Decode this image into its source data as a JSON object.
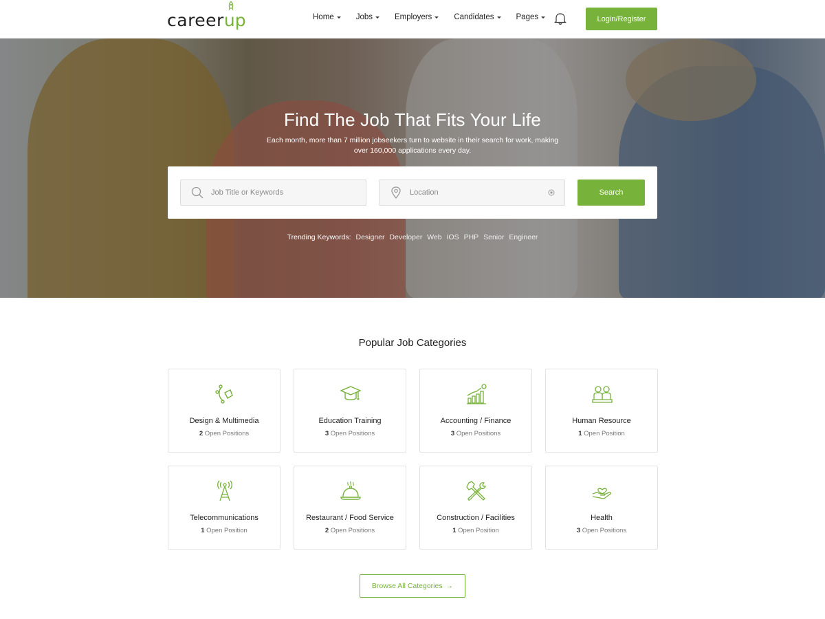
{
  "brand": {
    "name_part1": "career",
    "name_part2": "up",
    "accent": "#77b23b"
  },
  "nav": {
    "items": [
      {
        "label": "Home"
      },
      {
        "label": "Jobs"
      },
      {
        "label": "Employers"
      },
      {
        "label": "Candidates"
      },
      {
        "label": "Pages"
      }
    ],
    "notification_icon": "bell-icon",
    "login_label": "Login/Register"
  },
  "hero": {
    "title": "Find The Job That Fits Your Life",
    "subtitle": "Each month, more than 7 million jobseekers turn to website in their search for work, making over 160,000 applications every day.",
    "search": {
      "keyword_placeholder": "Job Title or Keywords",
      "location_placeholder": "Location",
      "button_label": "Search"
    },
    "trending": {
      "label": "Trending Keywords:",
      "keywords": [
        "Designer",
        "Developer",
        "Web",
        "IOS",
        "PHP",
        "Senior",
        "Engineer"
      ]
    }
  },
  "categories": {
    "title": "Popular Job Categories",
    "items": [
      {
        "name": "Design & Multimedia",
        "count": "2",
        "suffix": "Open Positions",
        "icon": "pen-tool-icon"
      },
      {
        "name": "Education Training",
        "count": "3",
        "suffix": "Open Positions",
        "icon": "graduation-cap-icon"
      },
      {
        "name": "Accounting / Finance",
        "count": "3",
        "suffix": "Open Positions",
        "icon": "finance-chart-icon"
      },
      {
        "name": "Human Resource",
        "count": "1",
        "suffix": "Open Position",
        "icon": "people-icon"
      },
      {
        "name": "Telecommunications",
        "count": "1",
        "suffix": "Open Position",
        "icon": "antenna-tower-icon"
      },
      {
        "name": "Restaurant / Food Service",
        "count": "2",
        "suffix": "Open Positions",
        "icon": "food-cloche-icon"
      },
      {
        "name": "Construction / Facilities",
        "count": "1",
        "suffix": "Open Position",
        "icon": "tools-icon"
      },
      {
        "name": "Health",
        "count": "3",
        "suffix": "Open Positions",
        "icon": "health-hand-icon"
      }
    ],
    "browse_label": "Browse All Categories",
    "browse_arrow": "→"
  }
}
